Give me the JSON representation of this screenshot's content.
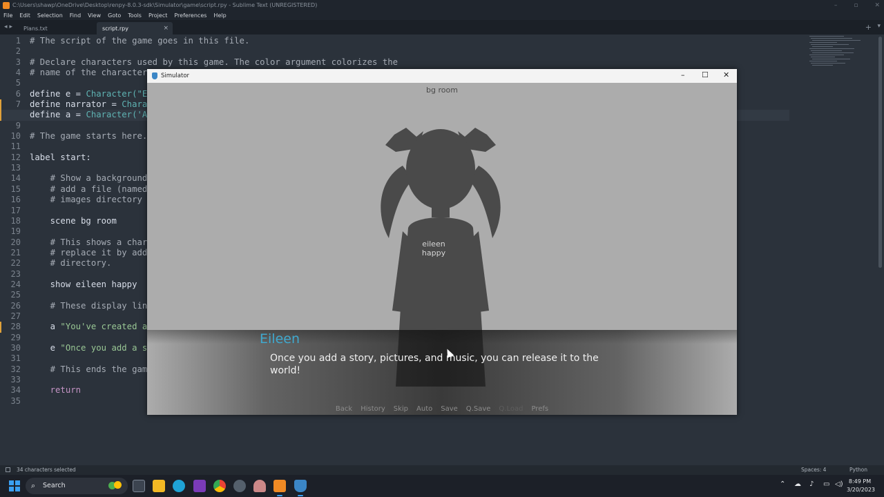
{
  "window": {
    "title": "C:\\Users\\shawp\\OneDrive\\Desktop\\renpy-8.0.3-sdk\\Simulator\\game\\script.rpy - Sublime Text (UNREGISTERED)"
  },
  "menu": [
    "File",
    "Edit",
    "Selection",
    "Find",
    "View",
    "Goto",
    "Tools",
    "Project",
    "Preferences",
    "Help"
  ],
  "tabs": [
    {
      "label": "Plans.txt",
      "active": false
    },
    {
      "label": "script.rpy",
      "active": true
    }
  ],
  "editor": {
    "line_numbers": [
      "1",
      "2",
      "3",
      "4",
      "5",
      "6",
      "7",
      "8",
      "9",
      "10",
      "11",
      "12",
      "13",
      "14",
      "15",
      "16",
      "17",
      "18",
      "19",
      "20",
      "21",
      "22",
      "23",
      "24",
      "25",
      "26",
      "27",
      "28",
      "29",
      "30",
      "31",
      "32",
      "33",
      "34",
      "35"
    ],
    "current_line": 8,
    "modified_lines": [
      7,
      8,
      28
    ],
    "lines": [
      [
        {
          "t": "# The script of the game goes in this file.",
          "c": "com"
        }
      ],
      [],
      [
        {
          "t": "# Declare characters used by this game. The color argument colorizes the",
          "c": "com"
        }
      ],
      [
        {
          "t": "# name of the character",
          "c": "com"
        }
      ],
      [],
      [
        {
          "t": "define e = ",
          "c": "kw"
        },
        {
          "t": "Character(\"E",
          "c": "fn"
        }
      ],
      [
        {
          "t": "define narrator = ",
          "c": "kw"
        },
        {
          "t": "Chara",
          "c": "fn"
        }
      ],
      [
        {
          "t": "define a = ",
          "c": "kw"
        },
        {
          "t": "Character('A",
          "c": "fn"
        }
      ],
      [],
      [
        {
          "t": "# The game starts here.",
          "c": "com"
        }
      ],
      [],
      [
        {
          "t": "label start:",
          "c": "kw"
        }
      ],
      [],
      [
        {
          "t": "    # Show a background",
          "c": "com"
        }
      ],
      [
        {
          "t": "    # add a file (named",
          "c": "com"
        }
      ],
      [
        {
          "t": "    # images directory ",
          "c": "com"
        }
      ],
      [],
      [
        {
          "t": "    scene bg room",
          "c": "kw"
        }
      ],
      [],
      [
        {
          "t": "    # This shows a char",
          "c": "com"
        }
      ],
      [
        {
          "t": "    # replace it by add",
          "c": "com"
        }
      ],
      [
        {
          "t": "    # directory.",
          "c": "com"
        }
      ],
      [],
      [
        {
          "t": "    show eileen happy",
          "c": "kw"
        }
      ],
      [],
      [
        {
          "t": "    # These display lin",
          "c": "com"
        }
      ],
      [],
      [
        {
          "t": "    a ",
          "c": "kw"
        },
        {
          "t": "\"You've created a",
          "c": "str"
        }
      ],
      [],
      [
        {
          "t": "    e ",
          "c": "kw"
        },
        {
          "t": "\"Once you add a s",
          "c": "str"
        }
      ],
      [],
      [
        {
          "t": "    # This ends the gam",
          "c": "com"
        }
      ],
      [],
      [
        {
          "t": "    return",
          "c": "ret"
        }
      ],
      []
    ]
  },
  "status": {
    "selection": "34 characters selected",
    "spaces": "Spaces: 4",
    "syntax": "Python"
  },
  "simulator": {
    "title": "Simulator",
    "scene_label": "bg room",
    "character_label_line1": "eileen",
    "character_label_line2": "happy",
    "speaker": "Eileen",
    "dialogue": "Once you add a story, pictures, and music, you can release it to the world!",
    "quick_menu": [
      {
        "label": "Back",
        "enabled": true
      },
      {
        "label": "History",
        "enabled": true
      },
      {
        "label": "Skip",
        "enabled": true
      },
      {
        "label": "Auto",
        "enabled": true
      },
      {
        "label": "Save",
        "enabled": true
      },
      {
        "label": "Q.Save",
        "enabled": true
      },
      {
        "label": "Q.Load",
        "enabled": false
      },
      {
        "label": "Prefs",
        "enabled": true
      }
    ],
    "speaker_color": "#40a9cf"
  },
  "taskbar": {
    "search_label": "Search",
    "time": "8:49 PM",
    "date": "3/20/2023"
  },
  "colors": {
    "editor_bg": "#2b323b",
    "accent": "#3aa0f3",
    "modified_marker": "#e0a13a"
  }
}
